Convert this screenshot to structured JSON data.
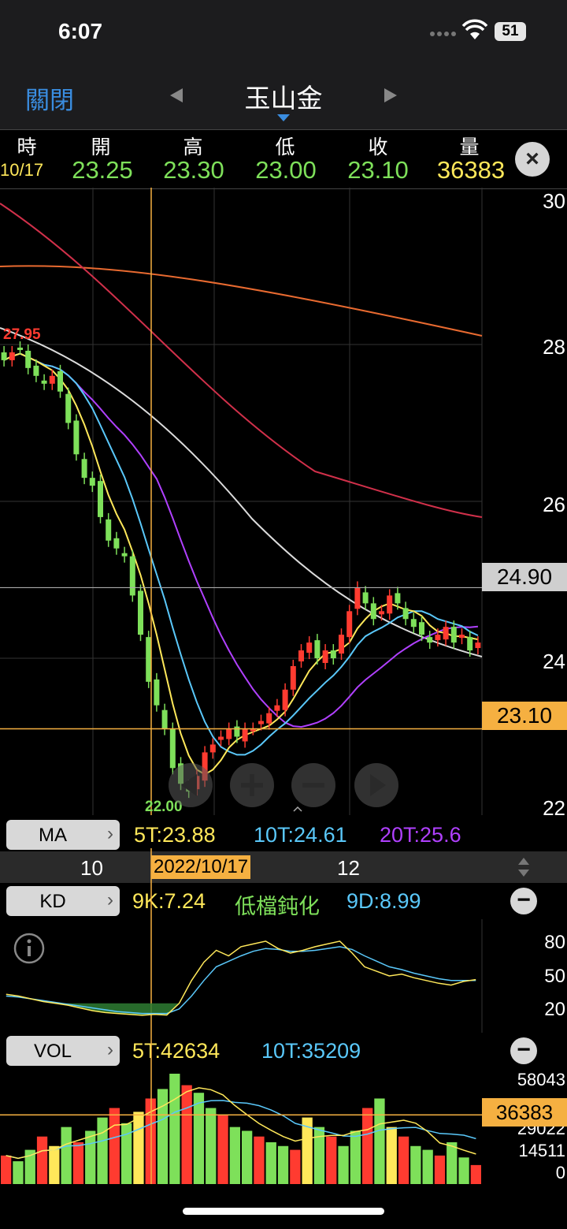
{
  "status": {
    "time": "6:07",
    "battery": "51"
  },
  "nav": {
    "close_label": "關閉",
    "title": "玉山金"
  },
  "ohlc": {
    "headers": [
      "時",
      "開",
      "高",
      "低",
      "收",
      "量"
    ],
    "date": "10/17",
    "open": "23.25",
    "high": "23.30",
    "low": "23.00",
    "close": "23.10",
    "volume": "36383"
  },
  "price_axis": {
    "labels": [
      "30",
      "28",
      "26",
      "24",
      "22"
    ],
    "crosshair_price": "24.90",
    "close_price": "23.10"
  },
  "annotations": {
    "high_mark": "27.95",
    "low_mark": "22.00"
  },
  "ma": {
    "button": "MA",
    "ma5": "5T:23.88",
    "ma10": "10T:24.61",
    "ma20": "20T:25.6"
  },
  "date_axis": {
    "left": "10",
    "selected": "2022/10/17",
    "right": "12"
  },
  "kd": {
    "button": "KD",
    "k": "9K:7.24",
    "status": "低檔鈍化",
    "d": "9D:8.99",
    "levels": [
      "80",
      "50",
      "20"
    ]
  },
  "vol": {
    "button": "VOL",
    "v5": "5T:42634",
    "v10": "10T:35209",
    "levels": [
      "58043",
      "29022",
      "14511",
      "0"
    ],
    "current": "36383"
  },
  "colors": {
    "up": "#ff3b30",
    "down": "#7ee05a",
    "ma5": "#ffe85a",
    "ma10": "#5ac8fa",
    "ma20": "#b040ff",
    "accent": "#f5b041"
  },
  "chart_data": {
    "type": "candlestick",
    "price_range": [
      22,
      30
    ],
    "close_series": [
      27.8,
      27.9,
      27.95,
      27.7,
      27.6,
      27.5,
      27.6,
      27.4,
      27.0,
      26.6,
      26.3,
      26.2,
      25.8,
      25.5,
      25.4,
      25.3,
      24.8,
      24.3,
      23.7,
      23.4,
      23.1,
      22.6,
      22.4,
      22.3,
      22.5,
      22.8,
      22.9,
      23.0,
      23.1,
      23.0,
      23.1,
      23.1,
      23.2,
      23.3,
      23.4,
      23.6,
      23.9,
      24.1,
      24.2,
      24.0,
      24.1,
      24.0,
      24.3,
      24.6,
      24.9,
      24.7,
      24.5,
      24.6,
      24.8,
      24.7,
      24.5,
      24.4,
      24.3,
      24.2,
      24.3,
      24.4,
      24.2,
      24.3,
      24.1,
      24.2
    ],
    "kd_k": [
      30,
      28,
      25,
      22,
      20,
      18,
      15,
      12,
      10,
      9,
      8,
      7,
      8,
      7.24,
      20,
      45,
      65,
      78,
      72,
      82,
      85,
      88,
      80,
      75,
      78,
      82,
      85,
      88,
      75,
      60,
      55,
      50,
      52,
      48,
      45,
      42,
      40,
      44,
      46
    ],
    "kd_d": [
      28,
      27,
      25,
      23,
      21,
      19,
      17,
      15,
      13,
      11,
      10,
      9,
      9,
      8.99,
      14,
      28,
      45,
      60,
      66,
      72,
      77,
      80,
      79,
      77,
      77,
      78,
      80,
      82,
      79,
      72,
      66,
      60,
      57,
      53,
      50,
      47,
      45,
      45,
      45
    ],
    "volume": [
      15000,
      12000,
      18000,
      25000,
      20000,
      30000,
      22000,
      28000,
      35000,
      40000,
      32000,
      38000,
      45000,
      50000,
      58043,
      52000,
      48000,
      40000,
      36383,
      30000,
      28000,
      25000,
      22000,
      20000,
      18000,
      35000,
      30000,
      25000,
      20000,
      28000,
      40000,
      45000,
      30000,
      25000,
      20000,
      18000,
      15000,
      22000,
      14000,
      10000
    ]
  }
}
